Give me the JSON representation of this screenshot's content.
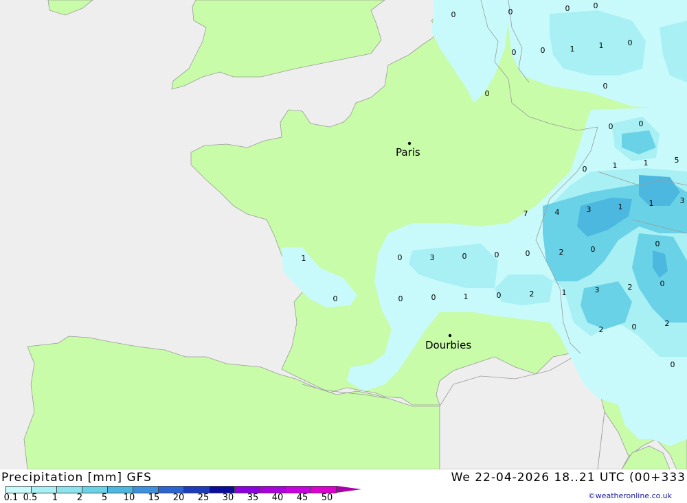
{
  "map": {
    "cities": [
      {
        "id": "paris",
        "name": "Paris"
      },
      {
        "id": "dourbies",
        "name": "Dourbies"
      }
    ],
    "precip_values": [
      "0",
      "0",
      "0",
      "0",
      "0",
      "0",
      "1",
      "1",
      "0",
      "0",
      "0",
      "0",
      "0",
      "0",
      "1",
      "1",
      "5",
      "7",
      "4",
      "3",
      "1",
      "1",
      "3",
      "2",
      "0",
      "0",
      "1",
      "0",
      "0",
      "3",
      "0",
      "0",
      "0",
      "0",
      "0",
      "1",
      "0",
      "2",
      "1",
      "3",
      "2",
      "0",
      "2",
      "2",
      "0",
      "0"
    ]
  },
  "legend": {
    "title": "Precipitation [mm] GFS",
    "datetime": "We 22-04-2026 18..21 UTC (00+333",
    "credit": "©weatheronline.co.uk",
    "ticks": [
      "0.1",
      "0.5",
      "1",
      "2",
      "5",
      "10",
      "15",
      "20",
      "25",
      "30",
      "35",
      "40",
      "45",
      "50"
    ],
    "colors": [
      "#c8fafc",
      "#a8f0f4",
      "#8ee4ee",
      "#6ad2e6",
      "#4cb8e0",
      "#3c90dc",
      "#2c64d0",
      "#1c3cbc",
      "#0c0c9c",
      "#8c00e0",
      "#aa00dc",
      "#c800e0",
      "#dc00d0",
      "#aa00aa"
    ],
    "land_color": "#c8fca8",
    "sea_color": "#eeeeee"
  }
}
